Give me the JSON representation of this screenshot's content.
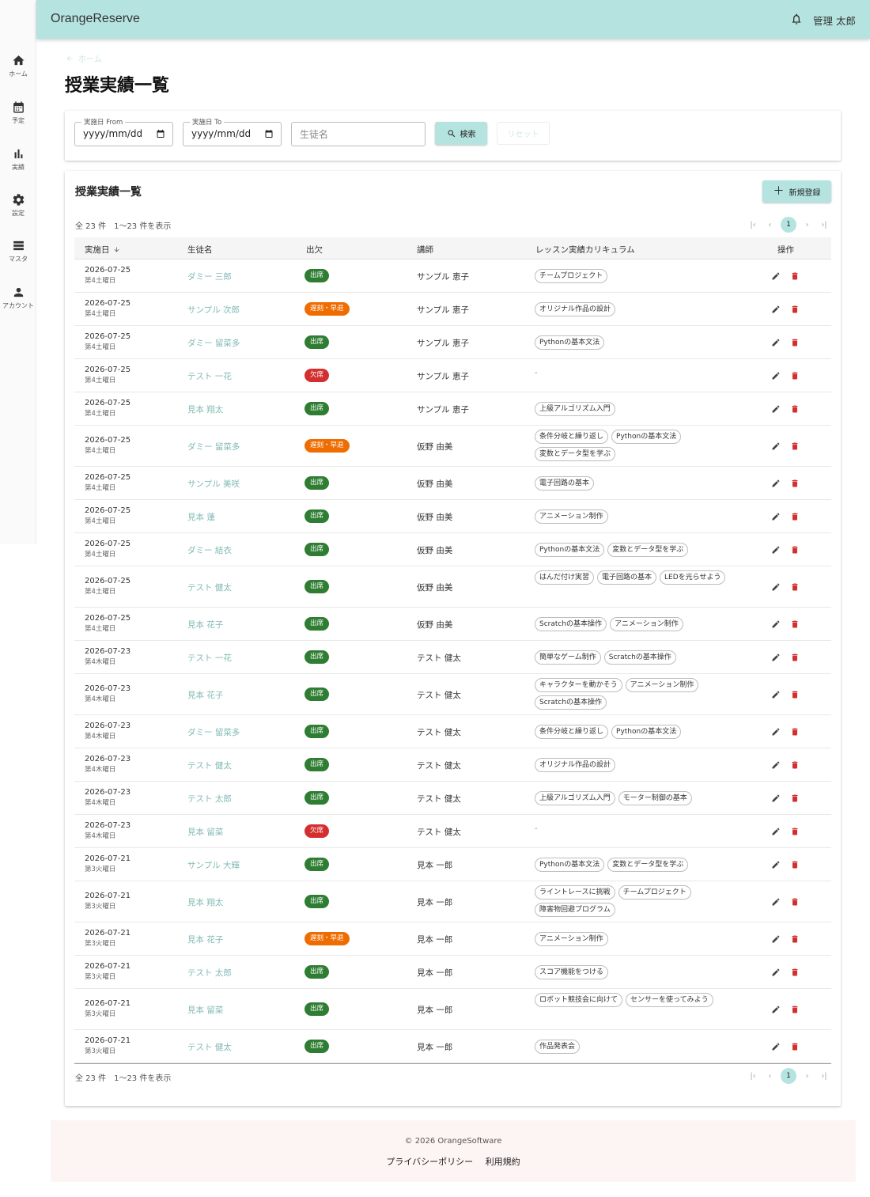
{
  "app": {
    "brand": "OrangeReserve",
    "user_name": "管理 太郎",
    "accent": "#b5e4e0"
  },
  "sidebar": {
    "items": [
      {
        "label": "ホーム",
        "icon": "home-icon"
      },
      {
        "label": "予定",
        "icon": "calendar-icon"
      },
      {
        "label": "実績",
        "icon": "bar-chart-icon"
      },
      {
        "label": "設定",
        "icon": "gear-icon"
      },
      {
        "label": "マスタ",
        "icon": "list-icon"
      },
      {
        "label": "アカウント",
        "icon": "person-icon"
      }
    ]
  },
  "breadcrumb": {
    "home": "ホーム"
  },
  "page": {
    "title": "授業実績一覧"
  },
  "filters": {
    "date_from_label": "実施日 From",
    "date_from_value": "yyyy/mm/dd",
    "date_to_label": "実施日 To",
    "date_to_value": "yyyy/mm/dd",
    "student_placeholder": "生徒名",
    "search_label": "検索",
    "reset_label": "リセット"
  },
  "list": {
    "title": "授業実績一覧",
    "new_label": "新規登録",
    "summary": "全 23 件　1〜23 件を表示",
    "current_page": "1",
    "columns": [
      "実施日",
      "生徒名",
      "出欠",
      "講師",
      "レッスン実績カリキュラム",
      "操作"
    ],
    "status_colors": {
      "出席": "#2e7d32",
      "遅刻・早退": "#ef6c00",
      "欠席": "#d32f2f"
    },
    "rows": [
      {
        "date": "2026-07-25",
        "week": "第4土曜日",
        "student": "ダミー 三郎",
        "attendance": "出席",
        "teacher": "サンプル 恵子",
        "curriculum": [
          "チームプロジェクト"
        ]
      },
      {
        "date": "2026-07-25",
        "week": "第4土曜日",
        "student": "サンプル 次郎",
        "attendance": "遅刻・早退",
        "teacher": "サンプル 恵子",
        "curriculum": [
          "オリジナル作品の設計"
        ]
      },
      {
        "date": "2026-07-25",
        "week": "第4土曜日",
        "student": "ダミー 留菜多",
        "attendance": "出席",
        "teacher": "サンプル 恵子",
        "curriculum": [
          "Pythonの基本文法"
        ]
      },
      {
        "date": "2026-07-25",
        "week": "第4土曜日",
        "student": "テスト 一花",
        "attendance": "欠席",
        "teacher": "サンプル 恵子",
        "curriculum": []
      },
      {
        "date": "2026-07-25",
        "week": "第4土曜日",
        "student": "見本 翔太",
        "attendance": "出席",
        "teacher": "サンプル 恵子",
        "curriculum": [
          "上級アルゴリズム入門"
        ]
      },
      {
        "date": "2026-07-25",
        "week": "第4土曜日",
        "student": "ダミー 留菜多",
        "attendance": "遅刻・早退",
        "teacher": "仮野 由美",
        "curriculum": [
          "条件分岐と繰り返し",
          "Pythonの基本文法",
          "変数とデータ型を学ぶ"
        ]
      },
      {
        "date": "2026-07-25",
        "week": "第4土曜日",
        "student": "サンプル 美咲",
        "attendance": "出席",
        "teacher": "仮野 由美",
        "curriculum": [
          "電子回路の基本"
        ]
      },
      {
        "date": "2026-07-25",
        "week": "第4土曜日",
        "student": "見本 蓮",
        "attendance": "出席",
        "teacher": "仮野 由美",
        "curriculum": [
          "アニメーション制作"
        ]
      },
      {
        "date": "2026-07-25",
        "week": "第4土曜日",
        "student": "ダミー 結衣",
        "attendance": "出席",
        "teacher": "仮野 由美",
        "curriculum": [
          "Pythonの基本文法",
          "変数とデータ型を学ぶ"
        ]
      },
      {
        "date": "2026-07-25",
        "week": "第4土曜日",
        "student": "テスト 健太",
        "attendance": "出席",
        "teacher": "仮野 由美",
        "curriculum": [
          "はんだ付け実習",
          "電子回路の基本",
          "LEDを光らせよう"
        ]
      },
      {
        "date": "2026-07-25",
        "week": "第4土曜日",
        "student": "見本 花子",
        "attendance": "出席",
        "teacher": "仮野 由美",
        "curriculum": [
          "Scratchの基本操作",
          "アニメーション制作"
        ]
      },
      {
        "date": "2026-07-23",
        "week": "第4木曜日",
        "student": "テスト 一花",
        "attendance": "出席",
        "teacher": "テスト 健太",
        "curriculum": [
          "簡単なゲーム制作",
          "Scratchの基本操作"
        ]
      },
      {
        "date": "2026-07-23",
        "week": "第4木曜日",
        "student": "見本 花子",
        "attendance": "出席",
        "teacher": "テスト 健太",
        "curriculum": [
          "キャラクターを動かそう",
          "アニメーション制作",
          "Scratchの基本操作"
        ]
      },
      {
        "date": "2026-07-23",
        "week": "第4木曜日",
        "student": "ダミー 留菜多",
        "attendance": "出席",
        "teacher": "テスト 健太",
        "curriculum": [
          "条件分岐と繰り返し",
          "Pythonの基本文法"
        ]
      },
      {
        "date": "2026-07-23",
        "week": "第4木曜日",
        "student": "テスト 健太",
        "attendance": "出席",
        "teacher": "テスト 健太",
        "curriculum": [
          "オリジナル作品の設計"
        ]
      },
      {
        "date": "2026-07-23",
        "week": "第4木曜日",
        "student": "テスト 太郎",
        "attendance": "出席",
        "teacher": "テスト 健太",
        "curriculum": [
          "上級アルゴリズム入門",
          "モーター制御の基本"
        ]
      },
      {
        "date": "2026-07-23",
        "week": "第4木曜日",
        "student": "見本 留菜",
        "attendance": "欠席",
        "teacher": "テスト 健太",
        "curriculum": []
      },
      {
        "date": "2026-07-21",
        "week": "第3火曜日",
        "student": "サンプル 大輝",
        "attendance": "出席",
        "teacher": "見本 一郎",
        "curriculum": [
          "Pythonの基本文法",
          "変数とデータ型を学ぶ"
        ]
      },
      {
        "date": "2026-07-21",
        "week": "第3火曜日",
        "student": "見本 翔太",
        "attendance": "出席",
        "teacher": "見本 一郎",
        "curriculum": [
          "ライントレースに挑戦",
          "チームプロジェクト",
          "障害物回避プログラム"
        ]
      },
      {
        "date": "2026-07-21",
        "week": "第3火曜日",
        "student": "見本 花子",
        "attendance": "遅刻・早退",
        "teacher": "見本 一郎",
        "curriculum": [
          "アニメーション制作"
        ]
      },
      {
        "date": "2026-07-21",
        "week": "第3火曜日",
        "student": "テスト 太郎",
        "attendance": "出席",
        "teacher": "見本 一郎",
        "curriculum": [
          "スコア機能をつける"
        ]
      },
      {
        "date": "2026-07-21",
        "week": "第3火曜日",
        "student": "見本 留菜",
        "attendance": "出席",
        "teacher": "見本 一郎",
        "curriculum": [
          "ロボット競技会に向けて",
          "センサーを使ってみよう"
        ]
      },
      {
        "date": "2026-07-21",
        "week": "第3火曜日",
        "student": "テスト 健太",
        "attendance": "出席",
        "teacher": "見本 一郎",
        "curriculum": [
          "作品発表会"
        ]
      }
    ],
    "empty_curriculum": "-"
  },
  "footer": {
    "copyright": "© 2026 OrangeSoftware",
    "privacy": "プライバシーポリシー",
    "terms": "利用規約"
  }
}
